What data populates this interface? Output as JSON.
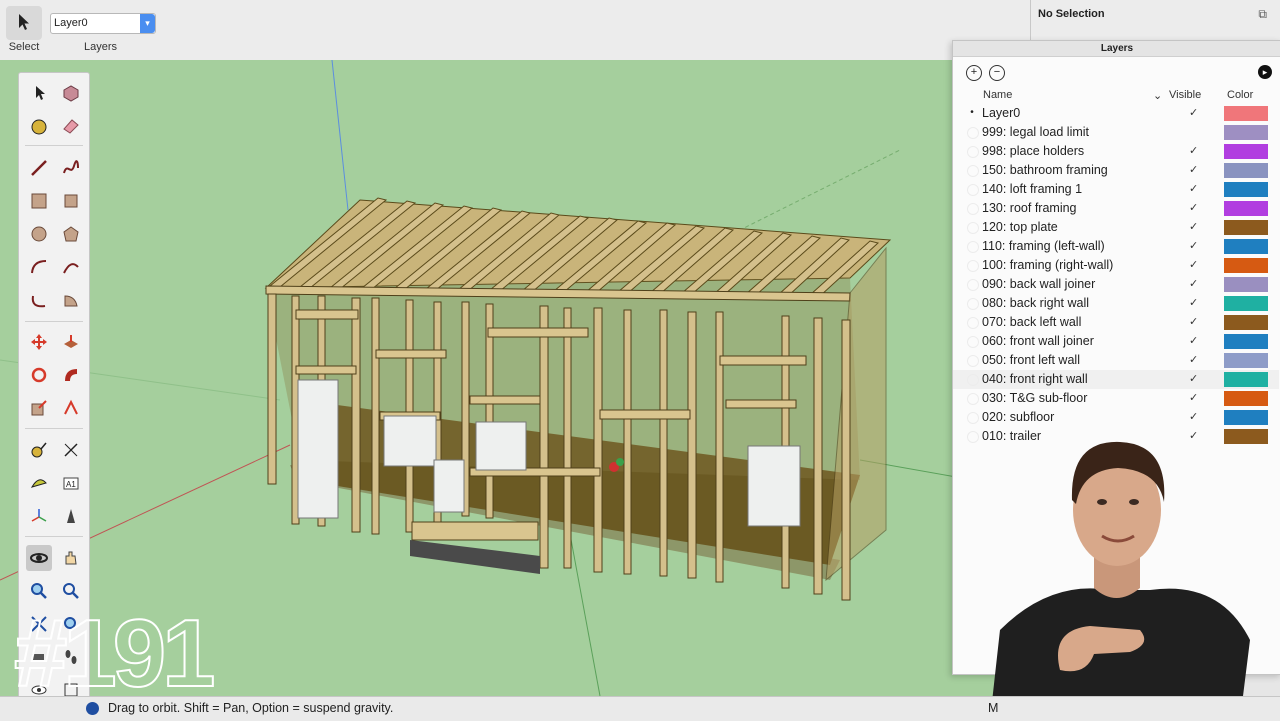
{
  "toolbar": {
    "select_label": "Select",
    "layer_value": "Layer0",
    "layers_label": "Layers"
  },
  "entity_info": {
    "title": "No Selection"
  },
  "layers_panel": {
    "title": "Layers",
    "col_name": "Name",
    "col_visible": "Visible",
    "col_color": "Color",
    "rows": [
      {
        "name": "Layer0",
        "active": true,
        "visible": "✓",
        "color": "#f0767a"
      },
      {
        "name": "999: legal load limit",
        "active": false,
        "visible": "",
        "color": "#9e8fc2"
      },
      {
        "name": "998: place holders",
        "active": false,
        "visible": "✓",
        "color": "#b13ee0"
      },
      {
        "name": "150: bathroom framing",
        "active": false,
        "visible": "✓",
        "color": "#8a93c0"
      },
      {
        "name": "140: loft framing 1",
        "active": false,
        "visible": "✓",
        "color": "#1f7fc0"
      },
      {
        "name": "130: roof framing",
        "active": false,
        "visible": "✓",
        "color": "#b13ee0"
      },
      {
        "name": "120: top plate",
        "active": false,
        "visible": "✓",
        "color": "#8c5a1e"
      },
      {
        "name": "110: framing (left-wall)",
        "active": false,
        "visible": "✓",
        "color": "#1f7fc0"
      },
      {
        "name": "100: framing (right-wall)",
        "active": false,
        "visible": "✓",
        "color": "#d65a12"
      },
      {
        "name": "090: back wall joiner",
        "active": false,
        "visible": "✓",
        "color": "#9a8fc0"
      },
      {
        "name": "080: back right wall",
        "active": false,
        "visible": "✓",
        "color": "#1fb0a2"
      },
      {
        "name": "070: back left wall",
        "active": false,
        "visible": "✓",
        "color": "#8c5a1e"
      },
      {
        "name": "060: front wall joiner",
        "active": false,
        "visible": "✓",
        "color": "#1f7fc0"
      },
      {
        "name": "050: front left wall",
        "active": false,
        "visible": "✓",
        "color": "#8e9cc8"
      },
      {
        "name": "040: front right wall",
        "active": false,
        "visible": "✓",
        "color": "#1fb0a2"
      },
      {
        "name": "030: T&G sub-floor",
        "active": false,
        "visible": "✓",
        "color": "#d65a12"
      },
      {
        "name": "020: subfloor",
        "active": false,
        "visible": "✓",
        "color": "#1f7fc0"
      },
      {
        "name": "010: trailer",
        "active": false,
        "visible": "✓",
        "color": "#8c5a1e"
      }
    ]
  },
  "status": {
    "hint": "Drag to orbit. Shift = Pan, Option = suspend gravity.",
    "measurements_label": "M"
  },
  "overlay": {
    "episode": "#191"
  }
}
